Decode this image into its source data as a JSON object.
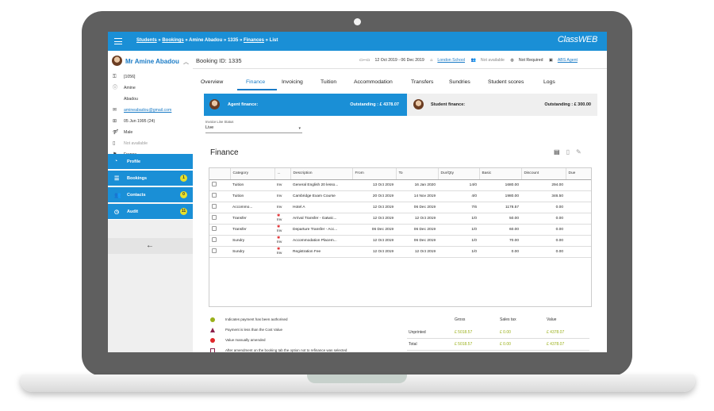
{
  "breadcrumb": {
    "students": "Students",
    "sep1": " » ",
    "bookings": "Bookings",
    "sep2": " » ",
    "person": "Amine Abadou",
    "sep3": " » ",
    "id": "1335",
    "sep4": " » ",
    "finances": "Finances",
    "sep5": " » ",
    "list": "List"
  },
  "logo": "ClassWEB",
  "profile": {
    "name": "Mr Amine Abadou",
    "info": [
      {
        "icon": "key-icon",
        "glyph": "⚿",
        "text": "[1056]",
        "style": ""
      },
      {
        "icon": "info-icon",
        "glyph": "ⓘ",
        "text": "Amine",
        "style": ""
      },
      {
        "icon": "",
        "glyph": "",
        "text": "Abadou",
        "style": ""
      },
      {
        "icon": "email-icon",
        "glyph": "✉",
        "text": "amineabadou@gmail.com",
        "style": "link"
      },
      {
        "icon": "cake-icon",
        "glyph": "⊞",
        "text": "05 Jun 1995 (24)",
        "style": ""
      },
      {
        "icon": "gender-icon",
        "glyph": "⚤",
        "text": "Male",
        "style": ""
      },
      {
        "icon": "phone-icon",
        "glyph": "▯",
        "text": "Not available",
        "style": "muted"
      },
      {
        "icon": "flag-icon",
        "glyph": "⚑",
        "text": "France",
        "style": ""
      }
    ]
  },
  "nav": [
    {
      "name": "nav-profile",
      "icon": "profile-icon",
      "glyph": "◔",
      "label": "Profile",
      "badge": ""
    },
    {
      "name": "nav-bookings",
      "icon": "list-icon",
      "glyph": "☰",
      "label": "Bookings",
      "badge": "1"
    },
    {
      "name": "nav-contacts",
      "icon": "people-icon",
      "glyph": "👥",
      "label": "Contacts",
      "badge": "0"
    },
    {
      "name": "nav-audit",
      "icon": "clock-icon",
      "glyph": "◷",
      "label": "Audit",
      "badge": "11"
    }
  ],
  "booking": {
    "title": "Booking ID: 1335",
    "dates": "12 Oct 2019 - 06 Dec 2019",
    "school": "London School",
    "agent_contact": "Not available",
    "requirement": "Not Required",
    "agent": "ABS Agent"
  },
  "tabs": [
    "Overview",
    "Finance",
    "Invoicing",
    "Tuition",
    "Accommodation",
    "Transfers",
    "Sundries",
    "Student scores",
    "Logs"
  ],
  "active_tab": "Finance",
  "agent_finance": {
    "label": "Agent finance:",
    "outstanding": "Outstanding : £ 4378.07"
  },
  "student_finance": {
    "label": "Student finance:",
    "outstanding": "Outstanding : £ 300.00"
  },
  "invoice_status": {
    "label": "Invoice Line Status",
    "value": "Live"
  },
  "finance_title": "Finance",
  "table": {
    "headers": [
      "Category",
      "...",
      "Description",
      "From",
      "To",
      "Dur/Qty",
      "Basic",
      "Discount",
      "Due"
    ],
    "rows": [
      {
        "category": "Tuition",
        "flag": "Inv",
        "star": false,
        "description": "General English 20 lesso...",
        "from": "13 Oct 2019",
        "to": "16 Jan 2020",
        "dur": "14/0",
        "basic": "1680.00",
        "discount": "294.00"
      },
      {
        "category": "Tuition",
        "flag": "Inv",
        "star": false,
        "description": "Cambridge Exam Course",
        "from": "20 Oct 2019",
        "to": "14 Nov 2019",
        "dur": "4/0",
        "basic": "1980.00",
        "discount": "346.50"
      },
      {
        "category": "Accommo...",
        "flag": "Inv",
        "star": false,
        "description": "Hotel A",
        "from": "12 Oct 2019",
        "to": "06 Dec 2019",
        "dur": "7/6",
        "basic": "1178.57",
        "discount": "0.00"
      },
      {
        "category": "Transfer",
        "flag": "Inv",
        "star": true,
        "description": "Arrival Transfer - Gatwic...",
        "from": "12 Oct 2019",
        "to": "12 Oct 2019",
        "dur": "1/0",
        "basic": "50.00",
        "discount": "0.00"
      },
      {
        "category": "Transfer",
        "flag": "Inv",
        "star": true,
        "description": "Departure Transfer - Acc...",
        "from": "06 Dec 2019",
        "to": "06 Dec 2019",
        "dur": "1/0",
        "basic": "60.00",
        "discount": "0.00"
      },
      {
        "category": "Sundry",
        "flag": "Inv",
        "star": true,
        "description": "Accommodation Placem...",
        "from": "12 Oct 2019",
        "to": "06 Dec 2019",
        "dur": "1/0",
        "basic": "70.00",
        "discount": "0.00"
      },
      {
        "category": "Sundry",
        "flag": "Inv",
        "star": true,
        "description": "Registration Fee",
        "from": "12 Oct 2019",
        "to": "12 Oct 2019",
        "dur": "1/0",
        "basic": "0.00",
        "discount": "0.00"
      }
    ]
  },
  "legend": [
    "Indicates payment has been authorised",
    "Payment is less than the Cost Value",
    "Value manually amended",
    "After amendment on the booking tab the option not to refinance was selected"
  ],
  "totals": {
    "headers": [
      "Gross",
      "Sales tax",
      "Value"
    ],
    "rows": [
      {
        "label": "Unprinted",
        "gross": "£ 5018.57",
        "tax": "£ 0.00",
        "value": "£ 4378.07"
      },
      {
        "label": "Total",
        "gross": "£ 5018.57",
        "tax": "£ 0.00",
        "value": "£ 4378.07"
      }
    ]
  },
  "colors": {
    "brand": "#1a8fd6",
    "badge": "#e8e02a",
    "amount_green": "#9ab01a",
    "alert_red": "#e0262a"
  }
}
